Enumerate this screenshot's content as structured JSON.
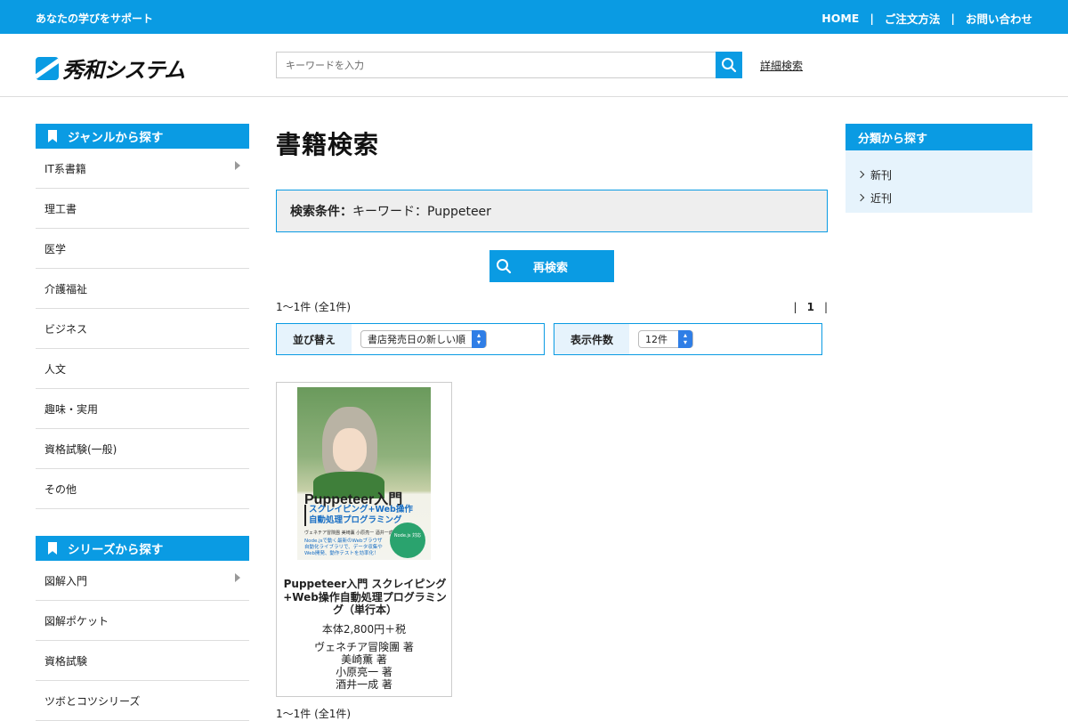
{
  "topbar": {
    "tagline": "あなたの学びをサポート",
    "nav": [
      "HOME",
      "ご注文方法",
      "お問い合わせ"
    ],
    "separator": "|"
  },
  "header": {
    "logo_text": "秀和システム",
    "search_placeholder": "キーワードを入力",
    "advanced_search": "詳細検索"
  },
  "sidebar": {
    "genre_title": "ジャンルから探す",
    "genres": [
      "IT系書籍",
      "理工書",
      "医学",
      "介護福祉",
      "ビジネス",
      "人文",
      "趣味・実用",
      "資格試験(一般)",
      "その他"
    ],
    "series_title": "シリーズから探す",
    "series": [
      "図解入門",
      "図解ポケット",
      "資格試験",
      "ツボとコツシリーズ"
    ]
  },
  "main": {
    "page_title": "書籍検索",
    "condition_label": "検索条件：",
    "condition_value": "キーワード：Puppeteer",
    "research_button": "再検索",
    "result_count": "1〜1件 (全1件)",
    "pager": [
      "|",
      "1",
      "|"
    ],
    "sort_label": "並び替え",
    "sort_value": "書店発売日の新しい順",
    "per_page_label": "表示件数",
    "per_page_value": "12件",
    "bottom_count": "1〜1件 (全1件)"
  },
  "product": {
    "cover_title": "Puppeteer入門",
    "cover_subtitle_1": "スクレイピング+Web操作",
    "cover_subtitle_2": "自動処理プログラミング",
    "cover_authors": "ヴェネチア冒険團 美崎薫 小原亮一 酒井一成 著",
    "cover_text": "Node.jsで動く最新のWebブラウザ自動化ライブラリで、データ収集やWeb開発、動作テストを効率化！",
    "cover_badge": "Node.js 対応",
    "title": "Puppeteer入門 スクレイピング+Web操作自動処理プログラミング（単行本）",
    "price": "本体2,800円＋税",
    "authors": [
      "ヴェネチア冒険團 著",
      "美崎薫 著",
      "小原亮一 著",
      "酒井一成 著"
    ]
  },
  "rside": {
    "title": "分類から探す",
    "items": [
      "新刊",
      "近刊"
    ]
  },
  "colors": {
    "accent": "#0a9be3",
    "light": "#e6f3fc"
  },
  "icons": [
    "search-icon",
    "bookmark-icon",
    "chevron-right-icon",
    "caret-right-icon",
    "select-arrows-icon"
  ]
}
